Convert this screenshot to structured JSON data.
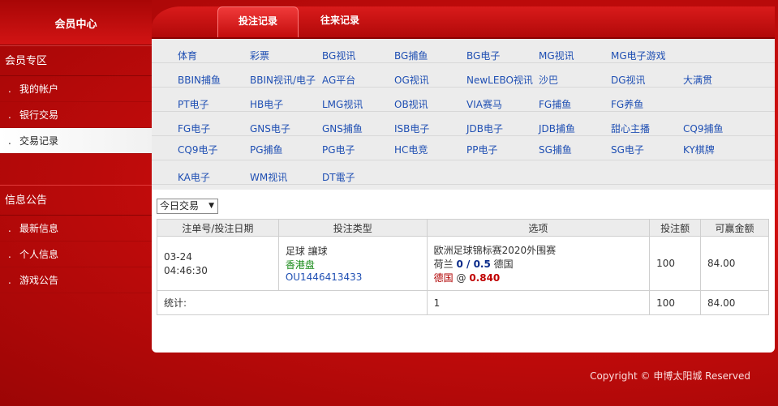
{
  "sidebar": {
    "title": "会员中心",
    "section1": "会员专区",
    "items1": [
      {
        "label": "我的帐户"
      },
      {
        "label": "银行交易"
      },
      {
        "label": "交易记录"
      }
    ],
    "section2": "信息公告",
    "items2": [
      {
        "label": "最新信息"
      },
      {
        "label": "个人信息"
      },
      {
        "label": "游戏公告"
      }
    ],
    "bullet": "."
  },
  "tabs": [
    {
      "label": "投注记录"
    },
    {
      "label": "往来记录"
    }
  ],
  "games": [
    [
      "体育",
      "彩票",
      "BG视讯",
      "BG捕鱼",
      "BG电子",
      "MG视讯",
      "MG电子游戏"
    ],
    [
      "BBIN捕鱼",
      "BBIN视讯/电子",
      "AG平台",
      "OG视讯",
      "NewLEBO视讯",
      "沙巴",
      "DG视讯",
      "大满贯"
    ],
    [
      "PT电子",
      "HB电子",
      "LMG视讯",
      "OB视讯",
      "VIA赛马",
      "FG捕鱼",
      "FG养鱼"
    ],
    [
      "FG电子",
      "GNS电子",
      "GNS捕鱼",
      "ISB电子",
      "JDB电子",
      "JDB捕鱼",
      "甜心主播",
      "CQ9捕鱼"
    ],
    [
      "CQ9电子",
      "PG捕鱼",
      "PG电子",
      "HC电竞",
      "PP电子",
      "SG捕鱼",
      "SG电子",
      "KY棋牌"
    ],
    [
      "KA电子",
      "WM视讯",
      "DT電子"
    ]
  ],
  "filter": {
    "value": "今日交易",
    "arrow": "▼"
  },
  "table": {
    "headers": [
      "注单号/投注日期",
      "投注类型",
      "选项",
      "投注额",
      "可赢金额"
    ],
    "row": {
      "date": "03-24",
      "time": "04:46:30",
      "sport": "足球 讓球",
      "market": "香港盘",
      "ticket": "OU1446413433",
      "league": "欧洲足球锦标赛2020外围赛",
      "home": "荷兰",
      "handicap": "0 / 0.5",
      "away": "德国",
      "pick": "德国",
      "at": "@",
      "odds": "0.840",
      "stake": "100",
      "win": "84.00"
    },
    "summary": {
      "label": "统计:",
      "count": "1",
      "stake": "100",
      "win": "84.00"
    }
  },
  "footer": "Copyright © 申博太阳城 Reserved"
}
